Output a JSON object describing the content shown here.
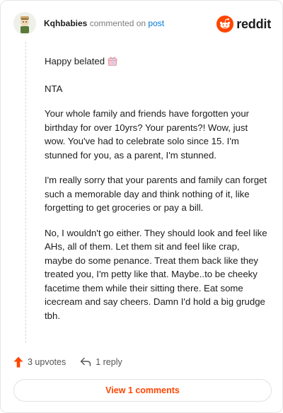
{
  "header": {
    "username": "Kqhbabies",
    "verb": "commented on",
    "link": "post",
    "brand": "reddit"
  },
  "comment": {
    "paragraphs": [
      "Happy belated",
      "NTA",
      "Your whole family and friends have forgotten your birthday for over 10yrs? Your parents?! Wow, just wow. You've had to celebrate solo since 15. I'm stunned for you, as a parent, I'm stunned.",
      "I'm really sorry that your parents and family can forget such a memorable day and think nothing of it, like forgetting to get groceries or pay a bill.",
      "No, I wouldn't go either. They should look and feel like AHs, all of them. Let them sit and feel like crap, maybe do some penance. Treat them back like they treated you, I'm petty like that. Maybe..to be cheeky facetime them while their sitting there. Eat some icecream and say cheers. Damn I'd hold a big grudge tbh."
    ],
    "emoji": "gift-icon"
  },
  "actions": {
    "upvotes": "3 upvotes",
    "replies": "1 reply"
  },
  "footer": {
    "view_label": "View 1 comments"
  },
  "colors": {
    "brand": "#ff4500",
    "link": "#0079d3"
  }
}
